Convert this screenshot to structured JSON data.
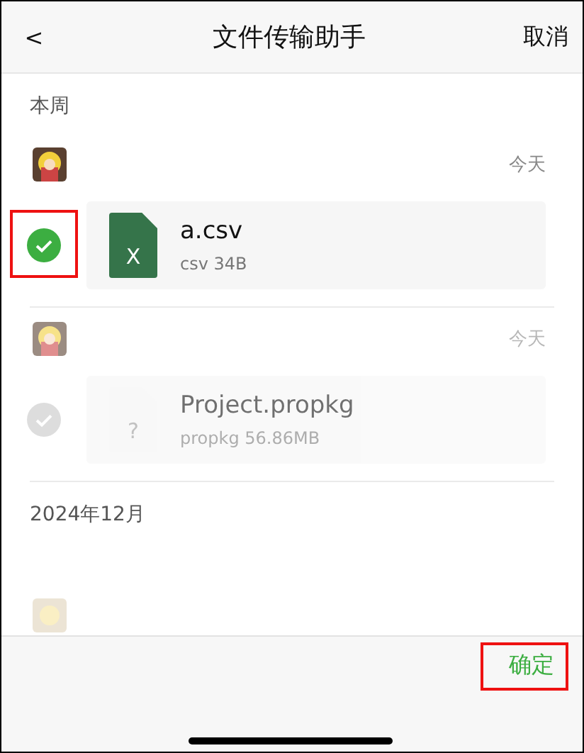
{
  "nav": {
    "back": "<",
    "title": "文件传输助手",
    "cancel": "取消"
  },
  "sections": [
    {
      "heading": "本周",
      "messages": [
        {
          "time": "今天",
          "file": {
            "kind": "excel",
            "name": "a.csv",
            "meta": "csv 34B",
            "glyph": "X"
          },
          "selected": true,
          "disabled": false,
          "highlighted": true
        },
        {
          "time": "今天",
          "file": {
            "kind": "unknown",
            "name": "Project.propkg",
            "meta": "propkg 56.86MB",
            "glyph": "?"
          },
          "selected": false,
          "disabled": true,
          "highlighted": false
        }
      ]
    },
    {
      "heading": "2024年12月",
      "messages": [
        {
          "partial": true
        }
      ]
    }
  ],
  "footer": {
    "confirm": "确定",
    "highlighted": true
  }
}
